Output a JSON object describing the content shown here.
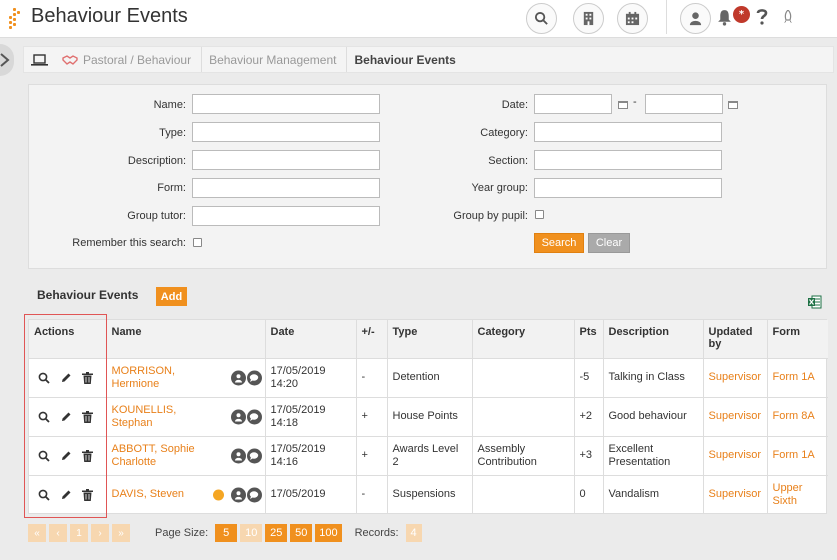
{
  "header": {
    "title": "Behaviour Events",
    "notification_count": "*"
  },
  "breadcrumb": {
    "items": [
      "Pastoral / Behaviour",
      "Behaviour Management",
      "Behaviour Events"
    ]
  },
  "search": {
    "labels": {
      "name": "Name:",
      "type": "Type:",
      "description": "Description:",
      "form": "Form:",
      "group_tutor": "Group tutor:",
      "remember": "Remember this search:",
      "date": "Date:",
      "category": "Category:",
      "section": "Section:",
      "year_group": "Year group:",
      "group_by_pupil": "Group by pupil:"
    },
    "date_separator": "-",
    "search_button": "Search",
    "clear_button": "Clear"
  },
  "events": {
    "title": "Behaviour Events",
    "add_button": "Add",
    "columns": [
      "Actions",
      "Name",
      "Date",
      "+/-",
      "Type",
      "Category",
      "Pts",
      "Description",
      "Updated by",
      "Form"
    ],
    "rows": [
      {
        "name": "MORRISON, Hermione",
        "date": "17/05/2019 14:20",
        "sign": "-",
        "type": "Detention",
        "category": "",
        "pts": "-5",
        "description": "Talking in Class",
        "updated_by": "Supervisor",
        "form": "Form 1A",
        "flag": false
      },
      {
        "name": "KOUNELLIS, Stephan",
        "date": "17/05/2019 14:18",
        "sign": "+",
        "type": "House Points",
        "category": "",
        "pts": "+2",
        "description": "Good behaviour",
        "updated_by": "Supervisor",
        "form": "Form 8A",
        "flag": false
      },
      {
        "name": "ABBOTT, Sophie Charlotte",
        "date": "17/05/2019 14:16",
        "sign": "+",
        "type": "Awards Level 2",
        "category": "Assembly Contribution",
        "pts": "+3",
        "description": "Excellent Presentation",
        "updated_by": "Supervisor",
        "form": "Form 1A",
        "flag": false
      },
      {
        "name": "DAVIS, Steven",
        "date": "17/05/2019",
        "sign": "-",
        "type": "Suspensions",
        "category": "",
        "pts": "0",
        "description": "Vandalism",
        "updated_by": "Supervisor",
        "form": "Upper Sixth",
        "flag": true
      }
    ]
  },
  "pager": {
    "first": "«",
    "prev": "‹",
    "current_page": "1",
    "next": "›",
    "last": "»",
    "page_size_label": "Page Size:",
    "page_sizes": [
      "5",
      "10",
      "25",
      "50",
      "100"
    ],
    "active_page_size": "10",
    "records_label": "Records:",
    "records": "4"
  },
  "colors": {
    "accent": "#f0901e",
    "link": "#e8801a",
    "highlight_box": "#e05555"
  }
}
